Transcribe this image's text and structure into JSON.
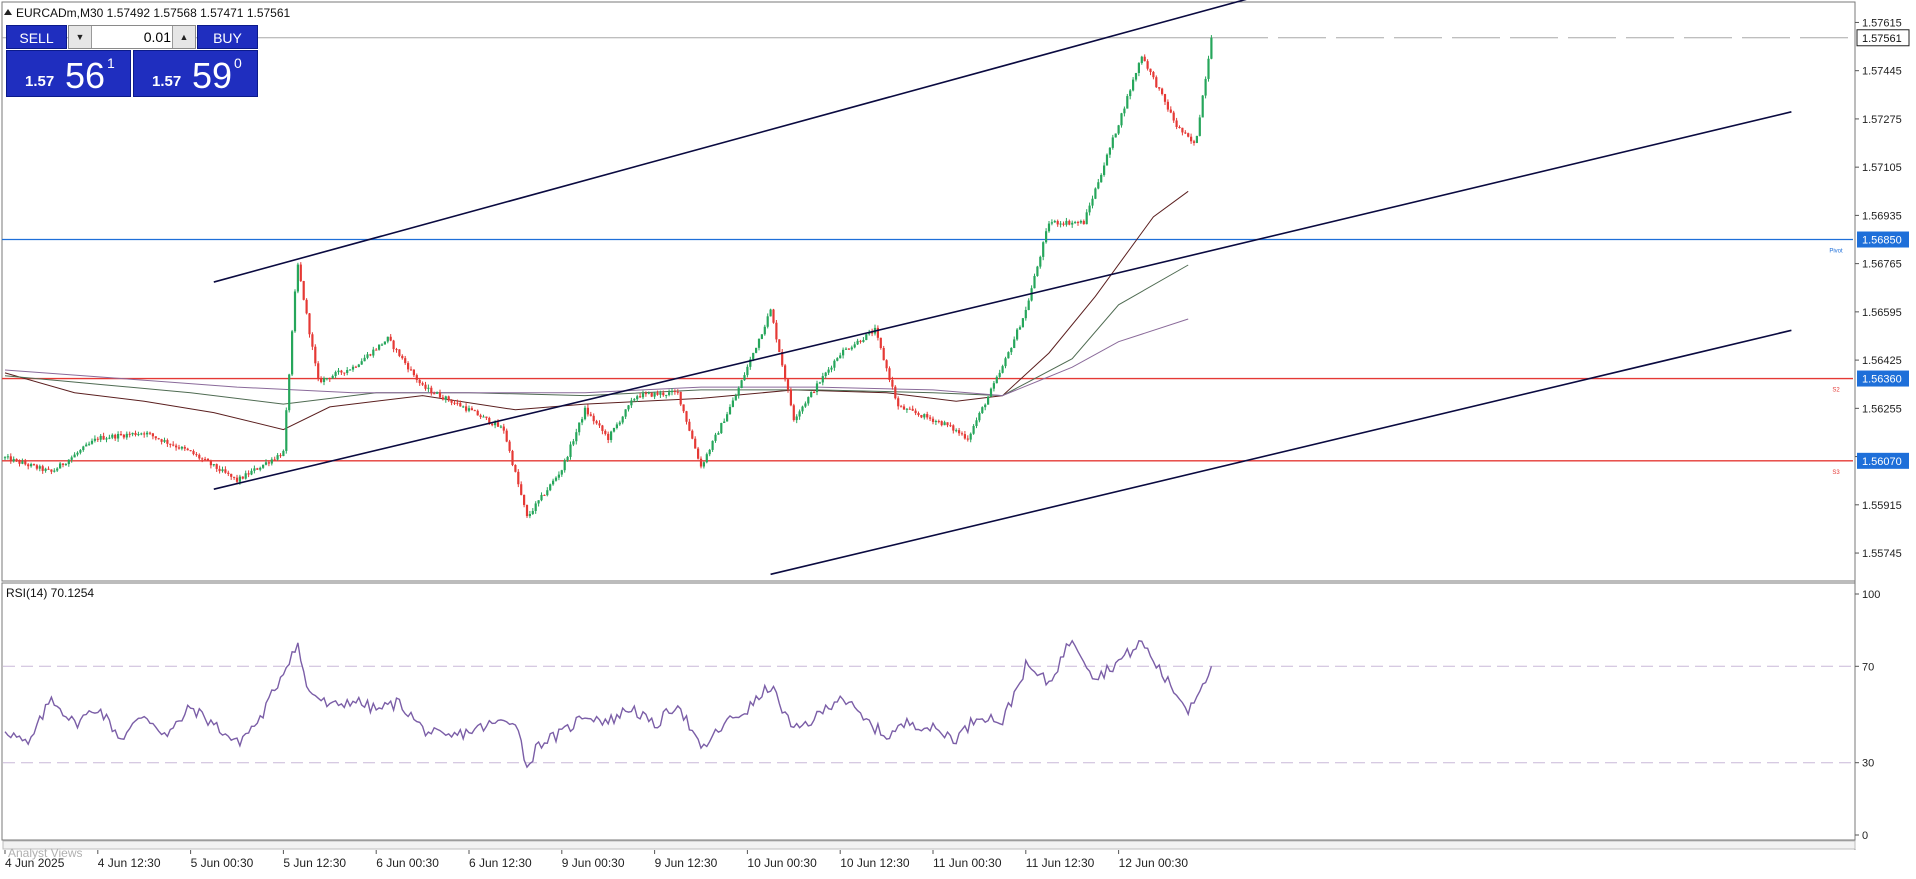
{
  "header": {
    "symbol_line": "EURCADm,M30  1.57492 1.57568 1.57471 1.57561"
  },
  "trade_panel": {
    "sell_label": "SELL",
    "buy_label": "BUY",
    "lot_value": "0.01",
    "decrease_icon": "triangle-down-icon",
    "increase_icon": "triangle-up-icon",
    "sell_prefix": "1.57",
    "sell_big": "56",
    "sell_sup": "1",
    "buy_prefix": "1.57",
    "buy_big": "59",
    "buy_sup": "0"
  },
  "analyst_views_label": "Analyst Views",
  "colors": {
    "bull": "#26a65b",
    "bear": "#e53935",
    "channel": "#0a0a40",
    "pivot": "#1e6fd9",
    "support": "#e53935",
    "rsi": "#7b5ea7",
    "badge": "#1e6fd9"
  },
  "chart_data": [
    {
      "type": "candlestick",
      "symbol": "EURCADm",
      "timeframe": "M30",
      "last_price": 1.57561,
      "ylim": [
        1.5565,
        1.5768
      ],
      "yticks": [
        1.57615,
        1.57445,
        1.57275,
        1.57105,
        1.56935,
        1.56765,
        1.56595,
        1.56425,
        1.56255,
        1.56085,
        1.55915,
        1.55745
      ],
      "y_badges": [
        {
          "label": "1.57561",
          "value": 1.57561,
          "style": "current"
        },
        {
          "label": "1.56850",
          "value": 1.5685,
          "style": "pivot"
        },
        {
          "label": "1.56360",
          "value": 1.5636,
          "style": "support"
        },
        {
          "label": "1.56070",
          "value": 1.5607,
          "style": "support"
        }
      ],
      "levels": [
        {
          "name": "Pivot",
          "value": 1.5685
        },
        {
          "name": "S2",
          "value": 1.5636
        },
        {
          "name": "S3",
          "value": 1.5607
        }
      ],
      "x_labels": [
        "4 Jun 2025",
        "4 Jun 12:30",
        "5 Jun 00:30",
        "5 Jun 12:30",
        "6 Jun 00:30",
        "6 Jun 12:30",
        "9 Jun 00:30",
        "9 Jun 12:30",
        "10 Jun 00:30",
        "10 Jun 12:30",
        "11 Jun 00:30",
        "11 Jun 12:30",
        "12 Jun 00:30"
      ],
      "channel_lines": [
        {
          "from": [
            9,
            1.567
          ],
          "to": [
            55,
            1.5773
          ]
        },
        {
          "from": [
            9,
            1.5597
          ],
          "to": [
            77,
            1.573
          ]
        },
        {
          "from": [
            33,
            1.5567
          ],
          "to": [
            77,
            1.5653
          ]
        }
      ],
      "close_path": [
        [
          0,
          1.5608
        ],
        [
          2,
          1.5603
        ],
        [
          4,
          1.5615
        ],
        [
          6,
          1.5617
        ],
        [
          8,
          1.561
        ],
        [
          10,
          1.56
        ],
        [
          12,
          1.561
        ],
        [
          12.6,
          1.5677
        ],
        [
          13.5,
          1.5635
        ],
        [
          15,
          1.564
        ],
        [
          16.5,
          1.565
        ],
        [
          18,
          1.5633
        ],
        [
          20,
          1.5625
        ],
        [
          21.5,
          1.5618
        ],
        [
          22.5,
          1.5587
        ],
        [
          24,
          1.5604
        ],
        [
          25,
          1.5625
        ],
        [
          26,
          1.5615
        ],
        [
          27.2,
          1.563
        ],
        [
          29,
          1.5631
        ],
        [
          30,
          1.5605
        ],
        [
          31.5,
          1.563
        ],
        [
          33,
          1.566
        ],
        [
          34,
          1.5622
        ],
        [
          36,
          1.5645
        ],
        [
          37.5,
          1.5653
        ],
        [
          38.5,
          1.5626
        ],
        [
          40.5,
          1.562
        ],
        [
          41.5,
          1.5615
        ],
        [
          43,
          1.564
        ],
        [
          44,
          1.566
        ],
        [
          45,
          1.5691
        ],
        [
          46.5,
          1.5691
        ],
        [
          48,
          1.5726
        ],
        [
          49,
          1.575
        ],
        [
          50.5,
          1.5725
        ],
        [
          51.3,
          1.5718
        ],
        [
          52,
          1.5756
        ]
      ],
      "moving_averages": [
        {
          "path": [
            [
              0,
              1.5638
            ],
            [
              3,
              1.5631
            ],
            [
              6,
              1.5628
            ],
            [
              9,
              1.5624
            ],
            [
              12,
              1.5618
            ],
            [
              14,
              1.5626
            ],
            [
              18,
              1.563
            ],
            [
              22,
              1.5625
            ],
            [
              25,
              1.5627
            ],
            [
              30,
              1.5629
            ],
            [
              34,
              1.5632
            ],
            [
              38,
              1.5631
            ],
            [
              41,
              1.5628
            ],
            [
              43,
              1.563
            ],
            [
              45,
              1.5645
            ],
            [
              47,
              1.5665
            ],
            [
              49.5,
              1.5693
            ],
            [
              51,
              1.5702
            ]
          ]
        },
        {
          "path": [
            [
              0,
              1.5637
            ],
            [
              4,
              1.5634
            ],
            [
              8,
              1.5631
            ],
            [
              12,
              1.5627
            ],
            [
              16,
              1.5631
            ],
            [
              20,
              1.5631
            ],
            [
              25,
              1.563
            ],
            [
              30,
              1.5632
            ],
            [
              35,
              1.5632
            ],
            [
              40,
              1.5631
            ],
            [
              43,
              1.563
            ],
            [
              46,
              1.5643
            ],
            [
              48,
              1.5662
            ],
            [
              51,
              1.5676
            ]
          ]
        },
        {
          "path": [
            [
              0,
              1.5639
            ],
            [
              5,
              1.5636
            ],
            [
              10,
              1.5633
            ],
            [
              15,
              1.5631
            ],
            [
              20,
              1.5631
            ],
            [
              25,
              1.5631
            ],
            [
              30,
              1.5633
            ],
            [
              35,
              1.5633
            ],
            [
              40,
              1.5632
            ],
            [
              43,
              1.563
            ],
            [
              46,
              1.564
            ],
            [
              48,
              1.5649
            ],
            [
              51,
              1.5657
            ]
          ]
        }
      ]
    },
    {
      "type": "line",
      "title": "RSI(14) 70.1254",
      "period": 14,
      "last_value": 70.1254,
      "ylim": [
        0,
        100
      ],
      "yticks": [
        100,
        70,
        30,
        0
      ],
      "levels": [
        70,
        30
      ],
      "values_path": [
        [
          0,
          44
        ],
        [
          1,
          37
        ],
        [
          2,
          57
        ],
        [
          3,
          46
        ],
        [
          4,
          53
        ],
        [
          5,
          40
        ],
        [
          6,
          50
        ],
        [
          7,
          41
        ],
        [
          8,
          53
        ],
        [
          9,
          46
        ],
        [
          10,
          38
        ],
        [
          11,
          48
        ],
        [
          12.6,
          80
        ],
        [
          13,
          61
        ],
        [
          14,
          53
        ],
        [
          15,
          56
        ],
        [
          16,
          52
        ],
        [
          17,
          55
        ],
        [
          18,
          44
        ],
        [
          19,
          40
        ],
        [
          20,
          43
        ],
        [
          21,
          46
        ],
        [
          22,
          48
        ],
        [
          22.5,
          28
        ],
        [
          23,
          38
        ],
        [
          24,
          42
        ],
        [
          25,
          50
        ],
        [
          26,
          47
        ],
        [
          27,
          53
        ],
        [
          28,
          45
        ],
        [
          29,
          55
        ],
        [
          30,
          35
        ],
        [
          31,
          46
        ],
        [
          32,
          52
        ],
        [
          33,
          62
        ],
        [
          34,
          43
        ],
        [
          35,
          49
        ],
        [
          36,
          58
        ],
        [
          37,
          48
        ],
        [
          38,
          41
        ],
        [
          39,
          47
        ],
        [
          40,
          44
        ],
        [
          41,
          40
        ],
        [
          42,
          50
        ],
        [
          43,
          47
        ],
        [
          44,
          70
        ],
        [
          45,
          63
        ],
        [
          46,
          82
        ],
        [
          47,
          65
        ],
        [
          48,
          72
        ],
        [
          49,
          80
        ],
        [
          50,
          65
        ],
        [
          51,
          52
        ],
        [
          52,
          70
        ]
      ]
    }
  ]
}
